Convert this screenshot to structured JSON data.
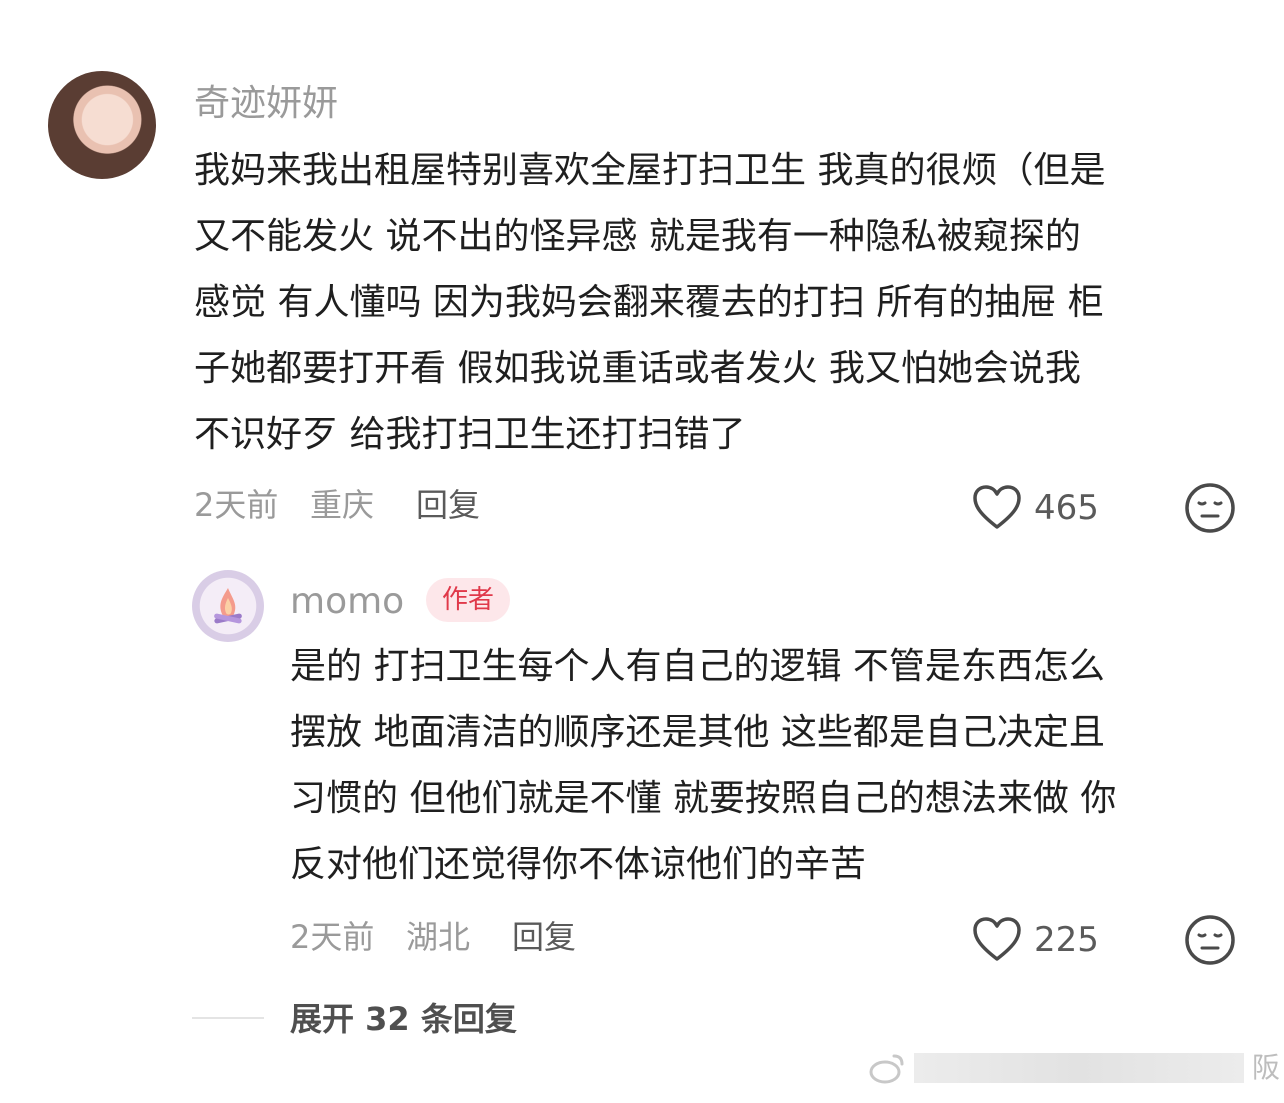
{
  "comment": {
    "username": "奇迹妍妍",
    "lines": [
      "我妈来我出租屋特别喜欢全屋打扫卫生 我真的很烦（但是",
      "又不能发火 说不出的怪异感  就是我有一种隐私被窥探的",
      "感觉 有人懂吗 因为我妈会翻来覆去的打扫 所有的抽屉 柜",
      "子她都要打开看 假如我说重话或者发火 我又怕她会说我",
      "不识好歹 给我打扫卫生还打扫错了"
    ],
    "time": "2天前",
    "location": "重庆",
    "reply_label": "回复",
    "like_count": "465"
  },
  "reply": {
    "username": "momo",
    "badge": "作者",
    "lines": [
      "是的 打扫卫生每个人有自己的逻辑 不管是东西怎么",
      "摆放 地面清洁的顺序还是其他 这些都是自己决定且",
      "习惯的 但他们就是不懂 就要按照自己的想法来做 你",
      "反对他们还觉得你不体谅他们的辛苦"
    ],
    "time": "2天前",
    "location": "湖北",
    "reply_label": "回复",
    "like_count": "225"
  },
  "expand_label": "展开 32 条回复",
  "watermark_char": "阪",
  "colors": {
    "text": "#1f1f1f",
    "muted": "#9a9a9a",
    "badge_bg": "#fde7ea",
    "badge_text": "#e0394a"
  }
}
